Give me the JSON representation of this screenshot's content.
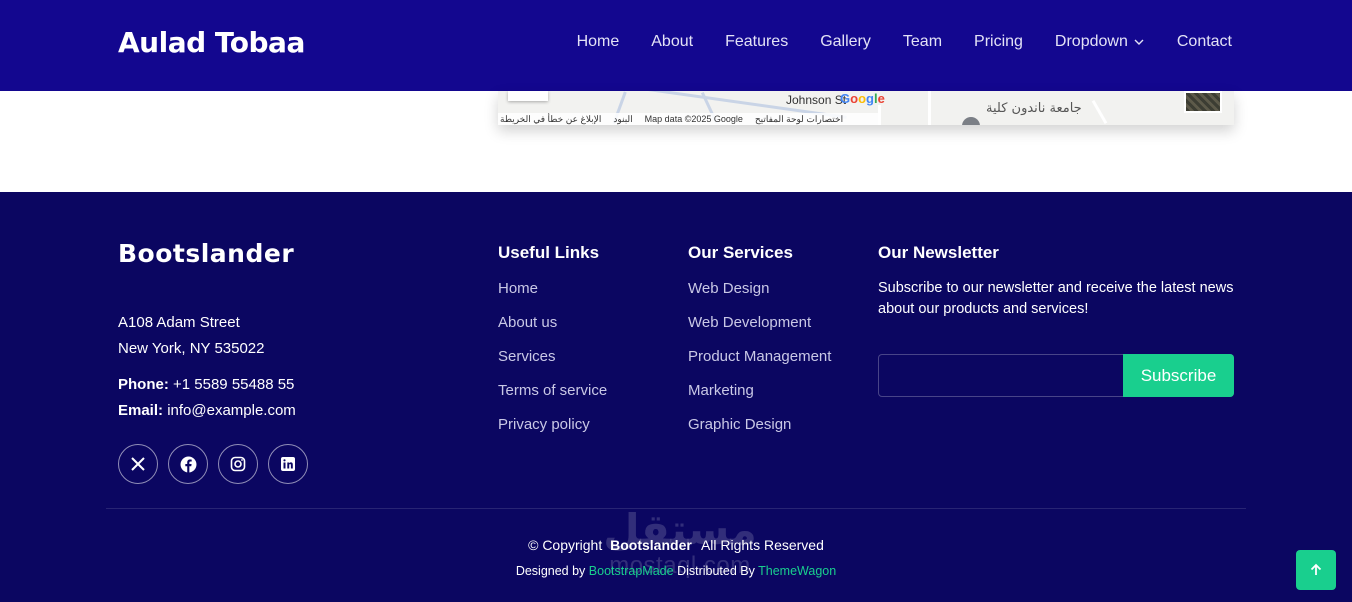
{
  "header": {
    "logo": "Aulad Tobaa",
    "nav": [
      "Home",
      "About",
      "Features",
      "Gallery",
      "Team",
      "Pricing",
      "Dropdown",
      "Contact"
    ]
  },
  "map": {
    "street_label": "Johnson St",
    "arabic_label": "جامعة ناندون كلية",
    "google_logo": "Google",
    "attribution": [
      "الإبلاغ عن خطأ في الخريطة",
      "البنود",
      "Map data ©2025 Google",
      "اختصارات لوحة المفاتيح"
    ]
  },
  "footer": {
    "brand": "Bootslander",
    "address_line1": "A108 Adam Street",
    "address_line2": "New York, NY 535022",
    "phone_label": "Phone:",
    "phone_value": "+1 5589 55488 55",
    "email_label": "Email:",
    "email_value": "info@example.com",
    "socials": [
      "x-icon",
      "facebook-icon",
      "instagram-icon",
      "linkedin-icon"
    ],
    "useful_links": {
      "title": "Useful Links",
      "items": [
        "Home",
        "About us",
        "Services",
        "Terms of service",
        "Privacy policy"
      ]
    },
    "services": {
      "title": "Our Services",
      "items": [
        "Web Design",
        "Web Development",
        "Product Management",
        "Marketing",
        "Graphic Design"
      ]
    },
    "newsletter": {
      "title": "Our Newsletter",
      "text": "Subscribe to our newsletter and receive the latest news about our products and services!",
      "input_value": "",
      "button": "Subscribe"
    },
    "copyright_prefix": "© Copyright",
    "copyright_brand": "Bootslander",
    "copyright_suffix": "All Rights Reserved",
    "designed_by": "Designed by",
    "designer": "BootstrapMade",
    "distributed_by": "Distributed By",
    "distributor": "ThemeWagon"
  },
  "watermark": {
    "arabic": "مستقل",
    "latin": "mostaql.com"
  },
  "scroll_top_icon": "arrow-up-icon",
  "colors": {
    "header_bg": "#13078f",
    "footer_bg": "#0b0661",
    "accent": "#19cf8e"
  }
}
